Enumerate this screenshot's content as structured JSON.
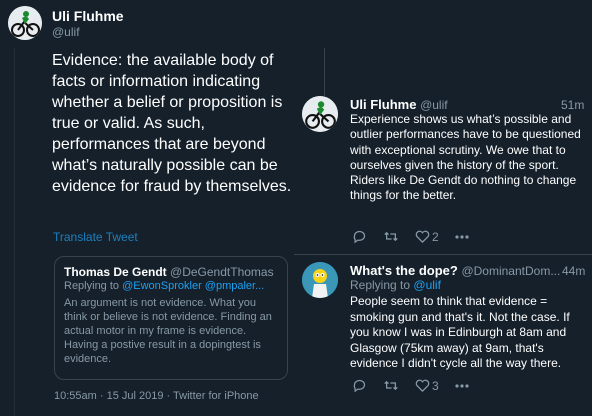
{
  "main": {
    "author_name": "Uli Fluhme",
    "author_handle": "@ulif",
    "body": "Evidence: the available body of facts or information indicating whether a belief or proposition is true or valid. As such, performances that are beyond what’s naturally possible can be evidence for fraud by themselves.",
    "translate": "Translate Tweet",
    "quoted": {
      "name": "Thomas De Gendt",
      "handle": "@DeGendtThomas",
      "reply_prefix": "Replying to",
      "reply_to": "@EwonSprokler @pmpaler...",
      "text": "An argument is not evidence. What you think or believe is not evidence. Finding an actual motor in my frame is evidence. Having a postive result in a dopingtest is evidence."
    },
    "timestamp": "10:55am · 15 Jul 2019 · Twitter for iPhone"
  },
  "reply1": {
    "author_name": "Uli Fluhme",
    "author_handle": "@ulif",
    "time": "51m",
    "body": "Experience shows us what’s possible and outlier performances have to be questioned with exceptional scrutiny. We owe that to ourselves given the history of the sport. Riders like De Gendt do nothing to change things for the better.",
    "like_count": "2"
  },
  "reply2": {
    "author_name": "What's the dope?",
    "author_handle": "@DominantDom...",
    "time": "44m",
    "reply_prefix": "Replying to",
    "reply_to": "@ulif",
    "body": "People seem to think that evidence = smoking gun and that's it. Not the case. If you know I was in Edinburgh at 8am and Glasgow (75km away) at 9am, that's evidence I didn't cycle all the way there.",
    "like_count": "3"
  },
  "icons": [
    "avatar-cyclist",
    "avatar-cartoon",
    "reply-icon",
    "retweet-icon",
    "like-icon",
    "more-icon"
  ],
  "colors": {
    "background": "#15202b",
    "border": "#38444d",
    "muted": "#8899a6",
    "link": "#1da1f2"
  }
}
